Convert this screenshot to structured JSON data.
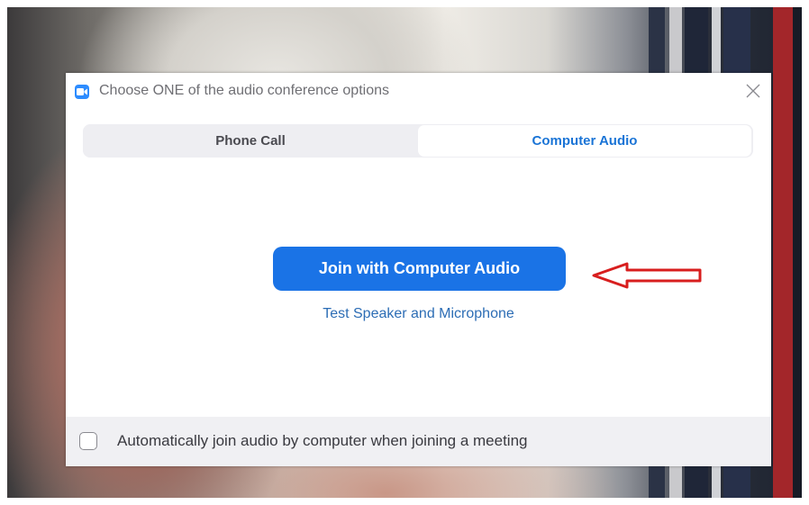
{
  "dialog": {
    "title": "Choose ONE of the audio conference options",
    "app_icon": "zoom-camera-icon",
    "close_icon": "close-icon"
  },
  "tabs": [
    {
      "label": "Phone Call",
      "selected": false
    },
    {
      "label": "Computer Audio",
      "selected": true
    }
  ],
  "main": {
    "join_button_label": "Join with Computer Audio",
    "test_link_label": "Test Speaker and Microphone",
    "annotation_icon": "red-arrow-left-icon"
  },
  "footer": {
    "checkbox_checked": false,
    "checkbox_label": "Automatically join audio by computer when joining a meeting"
  },
  "colors": {
    "accent": "#1a73e6",
    "selected_tab_text": "#1a74d6",
    "link": "#2c6db5",
    "annotation_arrow": "#d81e1e"
  }
}
